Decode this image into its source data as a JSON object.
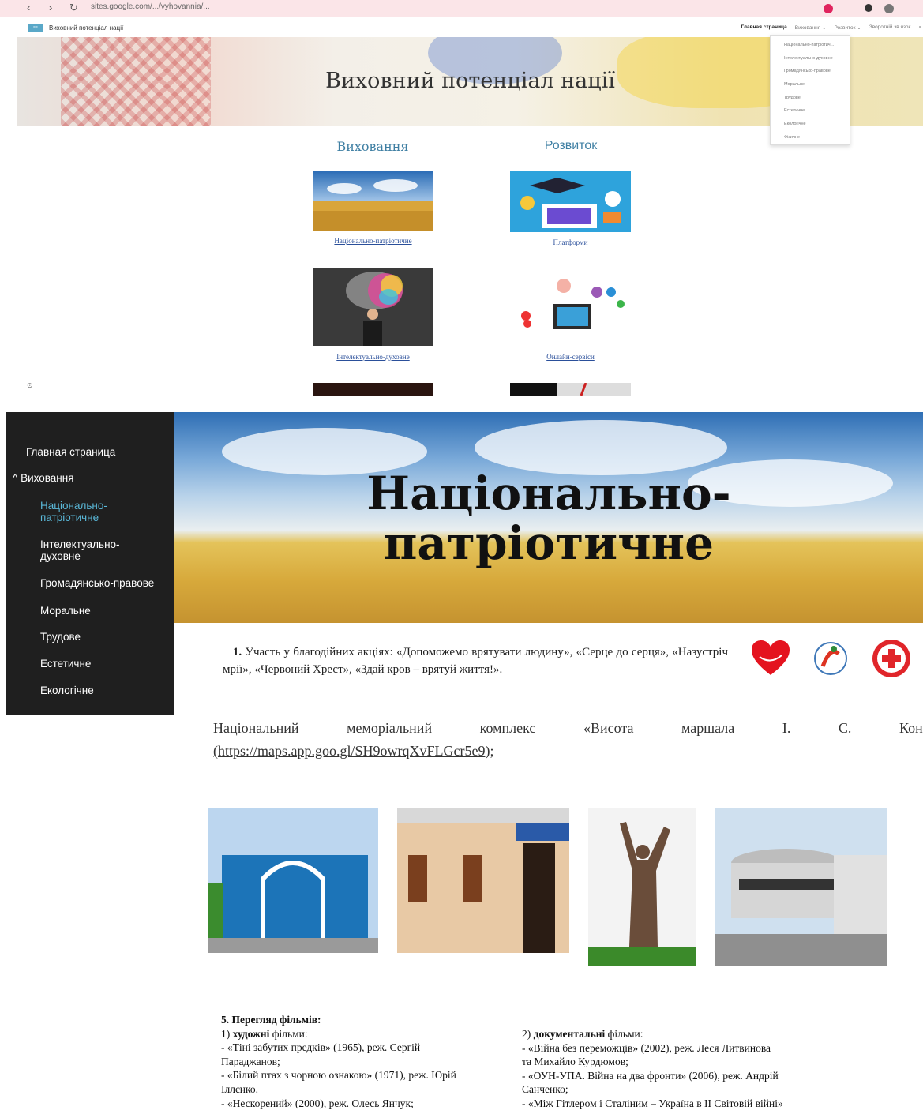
{
  "browser": {
    "url": "sites.google.com/.../vyhovannia/..."
  },
  "site_header": {
    "site_name": "Виховний потенціал нації",
    "nav": [
      "Главная страница",
      "Виховання ⌄",
      "Розвиток ⌄",
      "Зворотній зв язок"
    ]
  },
  "hero": {
    "title": "Виховний потенціал нації"
  },
  "dropdown": {
    "items": [
      "Національно-патріотич...",
      "Інтелектуально-духовне",
      "Громадянсько-правове",
      "Моральне",
      "Трудове",
      "Естетичне",
      "Екологічне",
      "Фізичне"
    ]
  },
  "columns": {
    "left_title": "Виховання",
    "right_title": "Розвиток",
    "left_items": [
      "Національно-патріотичне",
      "Інтелектуально-духовне"
    ],
    "right_items": [
      "Платформи",
      "Онлайн-сервіси"
    ]
  },
  "sidebar": {
    "home": "Главная страница",
    "section": "Виховання",
    "items": [
      "Національно-патріотичне",
      "Інтелектуально-духовне",
      "Громадянсько-правове",
      "Моральне",
      "Трудове",
      "Естетичне",
      "Екологічне"
    ]
  },
  "banner": {
    "title_line1": "Національно-",
    "title_line2": "патріотичне"
  },
  "article": {
    "p1_num": "1.",
    "p1_text": " Участь у благодійних акціях: «Допоможемо врятувати людину», «Серце до серця», «Назустріч мрії», «Червоний Хрест», «Здай кров – врятуй життя!».",
    "memo_words": [
      "Національний",
      "меморіальний",
      "комплекс",
      "«Висота",
      "маршала",
      "І.",
      "С.",
      "Конєва»"
    ],
    "memo_link": "(https://maps.app.goo.gl/SH9owrqXvFLGcr5e9);",
    "films_heading": "5. Перегляд фільмів:",
    "films_left": {
      "sub_num": "1)",
      "sub_bold": "художні",
      "sub_rest": " фільми:",
      "lines": [
        "- «Тіні забутих предків» (1965), реж. Сергій",
        "Параджанов;",
        "- «Білий птах з чорною ознакою» (1971), реж. Юрій",
        "Іллєнко.",
        "- «Нескорений» (2000), реж. Олесь Янчук;"
      ]
    },
    "films_right": {
      "sub_num": "2)",
      "sub_bold": "документальні",
      "sub_rest": " фільми:",
      "lines": [
        "- «Війна без переможців» (2002), реж. Леся Литвинова",
        "та Михайло Курдюмов;",
        "- «ОУН-УПА. Війна на два фронти» (2006), реж. Андрій",
        "Санченко;",
        "- «Між Гітлером і Сталіним – Україна в II Світовій війні»"
      ]
    }
  },
  "colors": {
    "accent": "#3f7fa3",
    "sidebar_bg": "#1f1f1f",
    "sidebar_active": "#5ab8d8",
    "link": "#2a4f9a"
  }
}
